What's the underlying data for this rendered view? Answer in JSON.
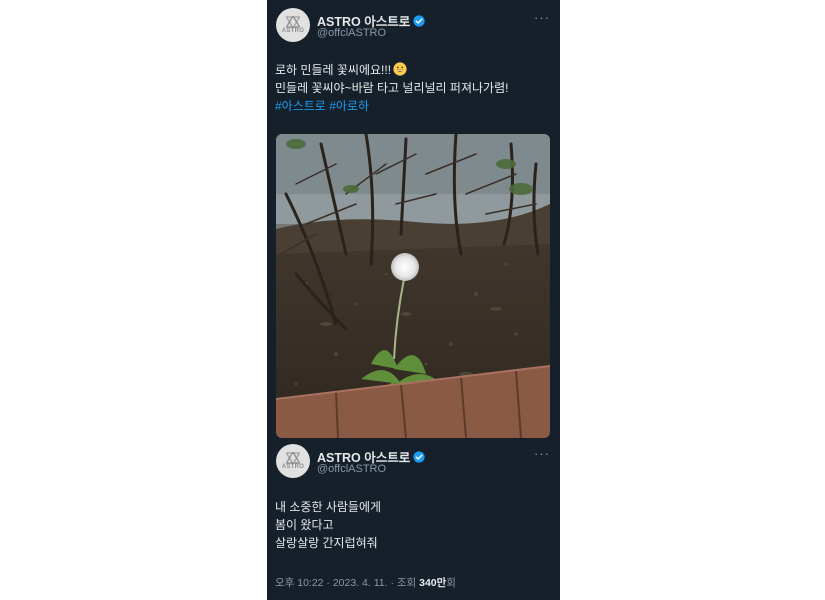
{
  "tweet": {
    "display_name": "ASTRO 아스트로",
    "handle": "@offclASTRO",
    "avatar_text": "ASTRO",
    "lines": [
      "로하 민들레 꽃씨에요!!!",
      "민들레 꽃씨야~바람 타고 널리널리 퍼져나가렴!"
    ],
    "hashtags": [
      "#아스트로",
      "#아로하"
    ]
  },
  "quoted": {
    "display_name": "ASTRO 아스트로",
    "handle": "@offclASTRO",
    "avatar_text": "ASTRO",
    "lines": [
      "내 소중한 사람들에게",
      "봄이 왔다고",
      "살랑살랑 간지럽혀줘"
    ]
  },
  "meta": {
    "time": "오후 10:22 · 2023. 4. 11. · 조회 ",
    "views": "340만",
    "views_suffix": "회"
  },
  "colors": {
    "background": "#15202b",
    "text": "#e7e9ea",
    "secondary": "#8b98a5",
    "link": "#1d9bf0",
    "verified": "#1d9bf0"
  }
}
